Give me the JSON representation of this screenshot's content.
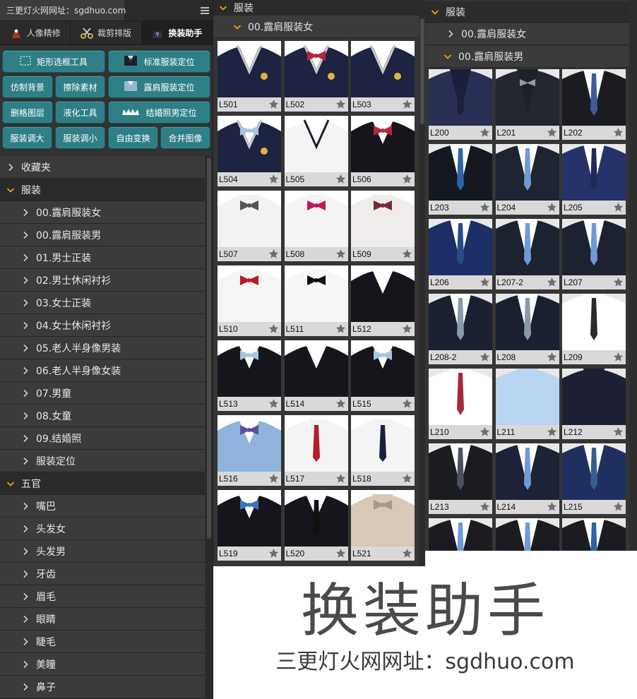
{
  "window": {
    "title": "三更灯火网网址：sgdhuo.com"
  },
  "tabs": [
    {
      "label": "人像精修",
      "icon": "portrait-icon"
    },
    {
      "label": "裁剪排版",
      "icon": "scissors-icon"
    },
    {
      "label": "换装助手",
      "icon": "suit-icon",
      "active": true
    }
  ],
  "tools": [
    {
      "label": "矩形选框工具",
      "icon": "marquee-icon"
    },
    {
      "label": "标准服装定位",
      "icon": "suit-icon"
    },
    {
      "label": "仿制背景",
      "icon": ""
    },
    {
      "label": "擦除素材",
      "icon": ""
    },
    {
      "label": "露肩服装定位",
      "icon": "shirt-icon"
    },
    {
      "label": "删格图层",
      "icon": ""
    },
    {
      "label": "液化工具",
      "icon": ""
    },
    {
      "label": "结婚照男定位",
      "icon": "crown-icon"
    },
    {
      "label": "服装调大",
      "icon": ""
    },
    {
      "label": "服装调小",
      "icon": ""
    },
    {
      "label": "自由变换",
      "icon": ""
    },
    {
      "label": "合并图像",
      "icon": ""
    }
  ],
  "tree": {
    "favorites": "收藏夹",
    "clothing": {
      "label": "服装",
      "items": [
        "00.露肩服装女",
        "00.露肩服装男",
        "01.男士正装",
        "02.男士休闲衬衫",
        "03.女士正装",
        "04.女士休闲衬衫",
        "05.老人半身像男装",
        "06.老人半身像女装",
        "07.男童",
        "08.女童",
        "09.结婚照",
        "服装定位"
      ]
    },
    "features": {
      "label": "五官",
      "items": [
        "嘴巴",
        "头发女",
        "头发男",
        "牙齿",
        "眉毛",
        "眼睛",
        "睫毛",
        "美瞳",
        "鼻子"
      ]
    }
  },
  "middle": {
    "header": "服装",
    "subheader": "00.露肩服装女",
    "thumbs": [
      "L501",
      "L502",
      "L503",
      "L504",
      "L505",
      "L506",
      "L507",
      "L508",
      "L509",
      "L510",
      "L511",
      "L512",
      "L513",
      "L514",
      "L515",
      "L516",
      "L517",
      "L518",
      "L519",
      "L520",
      "L521"
    ]
  },
  "right": {
    "header": "服装",
    "sub1": "00.露肩服装女",
    "sub2": "00.露肩服装男",
    "thumbs": [
      "L200",
      "L201",
      "L202",
      "L203",
      "L204",
      "L205",
      "L206",
      "L207-2",
      "L207",
      "L208-2",
      "L208",
      "L209",
      "L210",
      "L211",
      "L212",
      "L213",
      "L214",
      "L215",
      "",
      "",
      ""
    ]
  },
  "promo": {
    "title": "换装助手",
    "subtitle": "三更灯火网网址：sgdhuo.com"
  },
  "colors": {
    "panel": "#353535",
    "button_teal": "#2f7f86",
    "chevron_open": "#e8a317"
  }
}
